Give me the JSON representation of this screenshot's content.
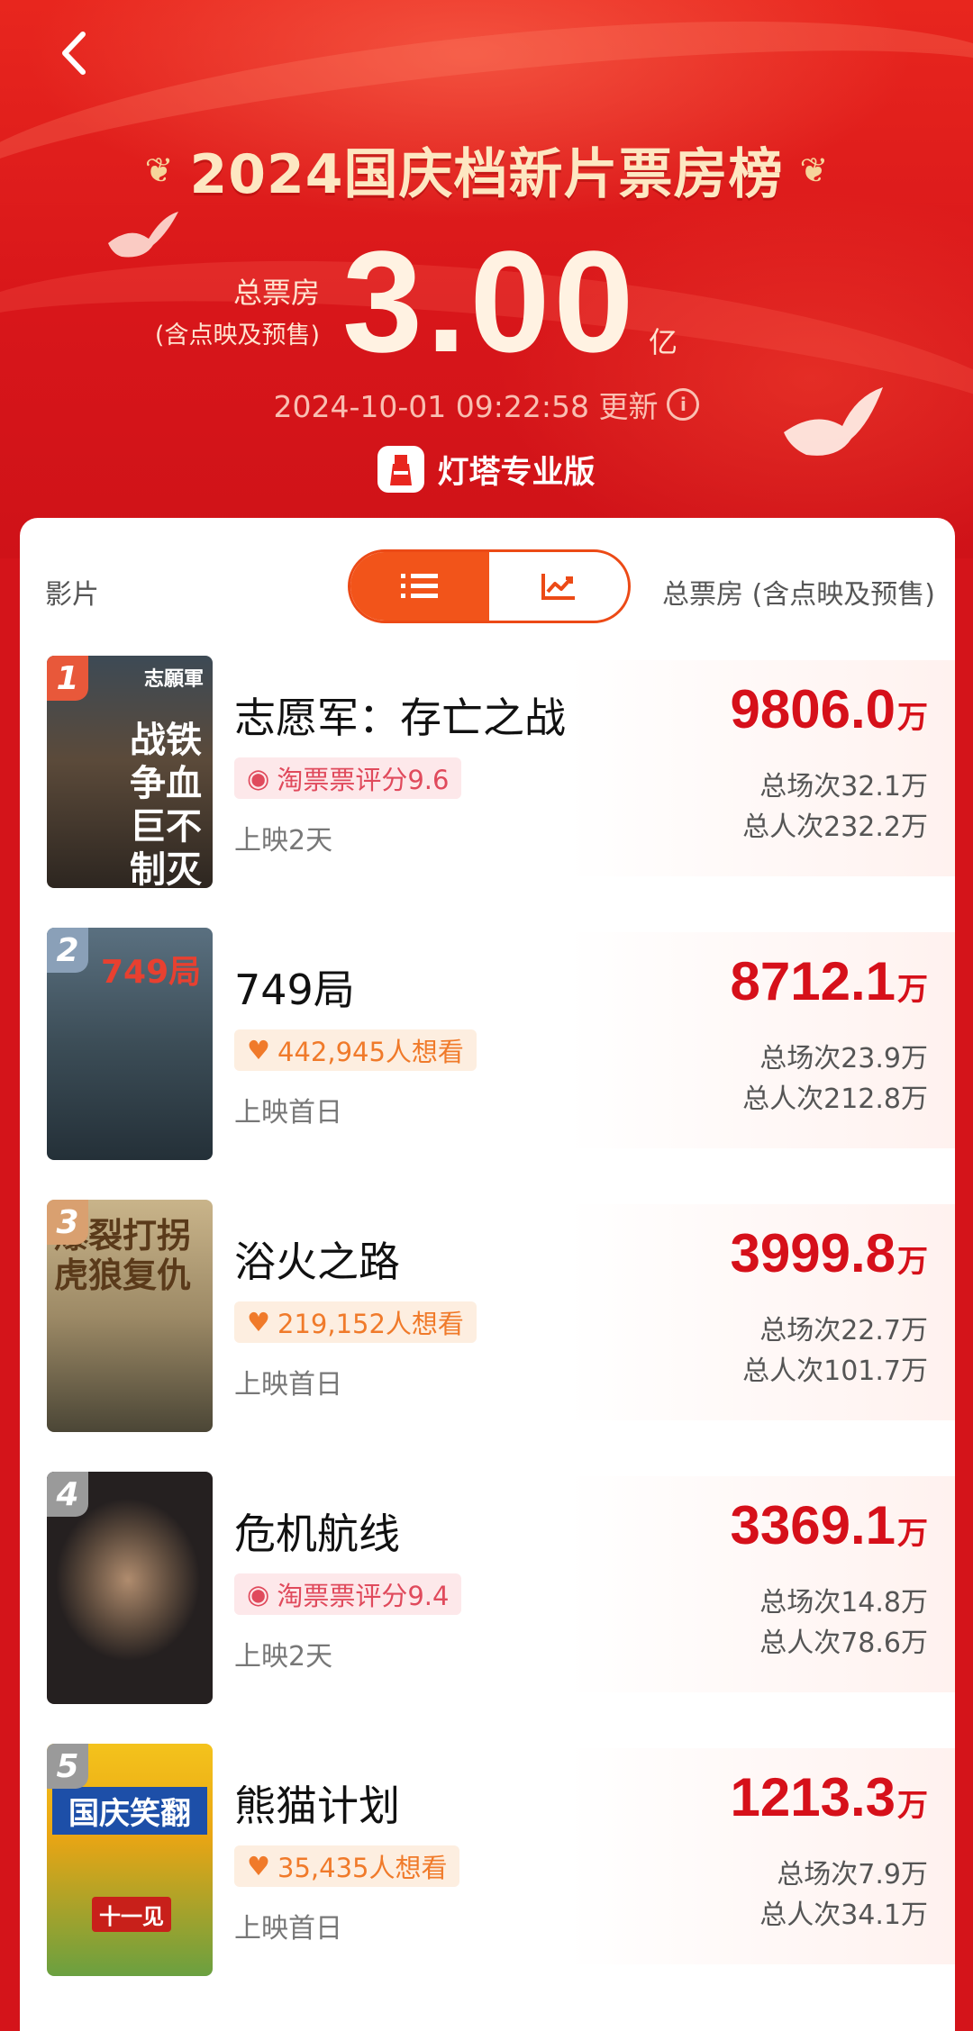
{
  "header": {
    "title": "2024国庆档新片票房榜",
    "total_label_line1": "总票房",
    "total_label_line2": "(含点映及预售)",
    "total_value": "3.00",
    "total_unit": "亿",
    "update_time": "2024-10-01 09:22:58 更新",
    "brand": "灯塔专业版"
  },
  "table_header": {
    "col_film": "影片",
    "col_total": "总票房 (含点映及预售)"
  },
  "films": [
    {
      "rank": "1",
      "name": "志愿军：存亡之战",
      "badge_type": "rating",
      "badge_text": "淘票票评分9.6",
      "days": "上映2天",
      "box_value": "9806.0",
      "box_unit": "万",
      "screenings": "总场次32.1万",
      "admissions": "总人次232.2万",
      "poster_text": "志願軍",
      "poster_sub": "战铁争血巨不制灭",
      "rank_color": "#e8583a"
    },
    {
      "rank": "2",
      "name": "749局",
      "badge_type": "want",
      "badge_text": "442,945人想看",
      "days": "上映首日",
      "box_value": "8712.1",
      "box_unit": "万",
      "screenings": "总场次23.9万",
      "admissions": "总人次212.8万",
      "poster_text": "749局",
      "poster_sub": "",
      "rank_color": "#8aa0b8"
    },
    {
      "rank": "3",
      "name": "浴火之路",
      "badge_type": "want",
      "badge_text": "219,152人想看",
      "days": "上映首日",
      "box_value": "3999.8",
      "box_unit": "万",
      "screenings": "总场次22.7万",
      "admissions": "总人次101.7万",
      "poster_text": "爆裂打拐",
      "poster_sub": "虎狼复仇",
      "rank_color": "#d9a070"
    },
    {
      "rank": "4",
      "name": "危机航线",
      "badge_type": "rating",
      "badge_text": "淘票票评分9.4",
      "days": "上映2天",
      "box_value": "3369.1",
      "box_unit": "万",
      "screenings": "总场次14.8万",
      "admissions": "总人次78.6万",
      "poster_text": "",
      "poster_sub": "",
      "rank_color": "#9a9a9a"
    },
    {
      "rank": "5",
      "name": "熊猫计划",
      "badge_type": "want",
      "badge_text": "35,435人想看",
      "days": "上映首日",
      "box_value": "1213.3",
      "box_unit": "万",
      "screenings": "总场次7.9万",
      "admissions": "总人次34.1万",
      "poster_text": "国庆笑翻",
      "poster_sub": "十一见",
      "rank_color": "#9a9a9a"
    }
  ],
  "colors": {
    "accent": "#f2541a",
    "box_red": "#d6101a",
    "hero_red": "#e8261e"
  }
}
